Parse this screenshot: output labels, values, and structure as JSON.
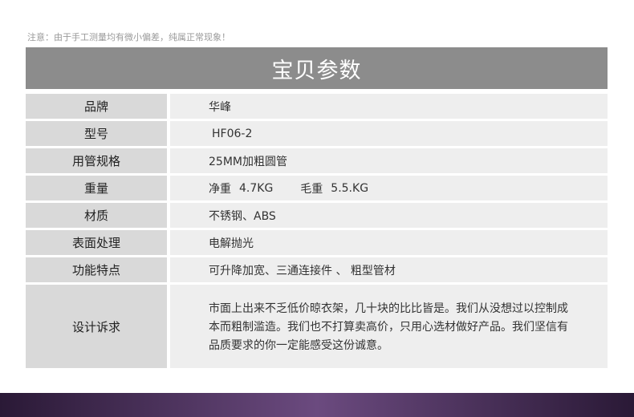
{
  "notice": "注意：由于手工测量均有微小偏差，纯属正常现象！",
  "banner_title": "宝贝参数",
  "specs": [
    {
      "key": "品牌",
      "value": "华峰"
    },
    {
      "key": "型号",
      "value": "HF06-2"
    },
    {
      "key": "用管规格",
      "value": "25MM加粗圆管"
    },
    {
      "key": "重量",
      "net_label": "净重",
      "net_value": "4.7KG",
      "gross_label": "毛重",
      "gross_value": "5.5.KG"
    },
    {
      "key": "材质",
      "value": "不锈钢、ABS"
    },
    {
      "key": "表面处理",
      "value": "电解抛光"
    },
    {
      "key": "功能特点",
      "value": "可升降加宽、三通连接件 、 粗型管材"
    },
    {
      "key": "设计诉求",
      "value": "市面上出来不乏低价晾衣架，几十块的比比皆是。我们从没想过以控制成本而粗制滥造。我们也不打算卖高价，只用心选材做好产品。我们坚信有品质要求的你一定能感受这份诚意。"
    }
  ]
}
